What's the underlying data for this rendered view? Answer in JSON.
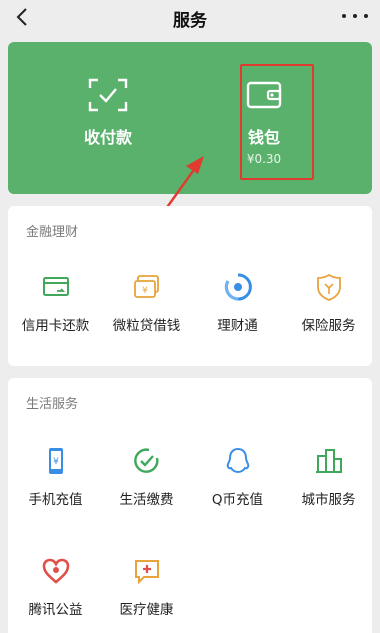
{
  "header": {
    "title": "服务"
  },
  "wallet_card": {
    "pay_label": "收付款",
    "wallet_label": "钱包",
    "wallet_balance": "¥0.30"
  },
  "finance": {
    "title": "金融理财",
    "items": [
      {
        "label": "信用卡还款",
        "icon": "credit-card-icon"
      },
      {
        "label": "微粒贷借钱",
        "icon": "loan-icon"
      },
      {
        "label": "理财通",
        "icon": "wealth-icon"
      },
      {
        "label": "保险服务",
        "icon": "insurance-icon"
      }
    ]
  },
  "life": {
    "title": "生活服务",
    "items": [
      {
        "label": "手机充值",
        "icon": "phone-topup-icon"
      },
      {
        "label": "生活缴费",
        "icon": "utility-payment-icon"
      },
      {
        "label": "Q币充值",
        "icon": "qcoin-icon"
      },
      {
        "label": "城市服务",
        "icon": "city-service-icon"
      },
      {
        "label": "腾讯公益",
        "icon": "charity-icon"
      },
      {
        "label": "医疗健康",
        "icon": "medical-icon"
      }
    ]
  },
  "colors": {
    "card_green": "#5ab16c",
    "highlight_red": "#e03b2e",
    "icon_green": "#3fa85a",
    "icon_orange": "#e8a33a",
    "icon_blue": "#3a8ee6"
  }
}
